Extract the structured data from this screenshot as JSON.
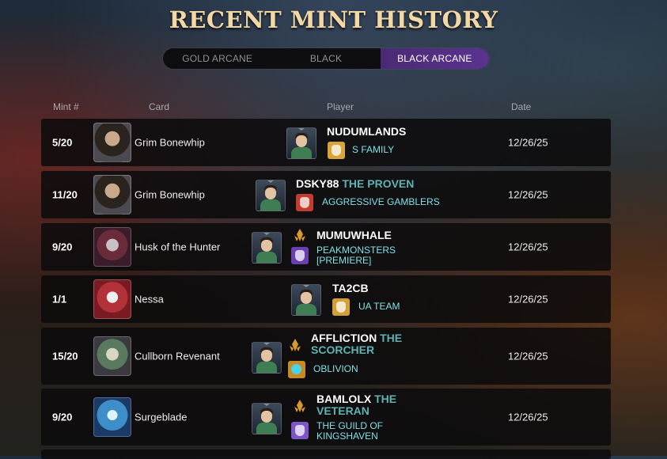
{
  "title": "RECENT MINT HISTORY",
  "tabs": [
    "GOLD ARCANE",
    "BLACK",
    "BLACK ARCANE"
  ],
  "active_tab": "BLACK ARCANE",
  "headers": {
    "mint": "Mint #",
    "card": "Card",
    "player": "Player",
    "date": "Date"
  },
  "rows": [
    {
      "mint": "5/20",
      "card": "Grim Bonewhip",
      "player": "NUDUMLANDS",
      "title": "",
      "guild": "S FAMILY",
      "date": "12/26/25"
    },
    {
      "mint": "11/20",
      "card": "Grim Bonewhip",
      "player": "DSKY88",
      "title": "THE PROVEN",
      "guild": "AGGRESSIVE GAMBLERS",
      "date": "12/26/25"
    },
    {
      "mint": "9/20",
      "card": "Husk of the Hunter",
      "player": "MUMUWHALE",
      "title": "",
      "guild_line1": "PEAKMONSTERS",
      "guild_line2": "[PREMIERE]",
      "date": "12/26/25"
    },
    {
      "mint": "1/1",
      "card": "Nessa",
      "player": "TA2CB",
      "title": "",
      "guild": "UA TEAM",
      "date": "12/26/25"
    },
    {
      "mint": "15/20",
      "card": "Cullborn Revenant",
      "player": "AFFLICTION",
      "title_line1": "THE",
      "title_line2": "SCORCHER",
      "guild": "OBLIVION",
      "date": "12/26/25"
    },
    {
      "mint": "9/20",
      "card": "Surgeblade",
      "player": "BAMLOLX",
      "title_line1": "THE",
      "title_line2": "VETERAN",
      "guild_line1": "THE GUILD OF",
      "guild_line2": "KINGSHAVEN",
      "date": "12/26/25"
    }
  ],
  "colors": {
    "accent": "#5b3390",
    "title": "#f3d7a4",
    "guild": "#7fe0e6",
    "player_title": "#5fb3b3"
  }
}
